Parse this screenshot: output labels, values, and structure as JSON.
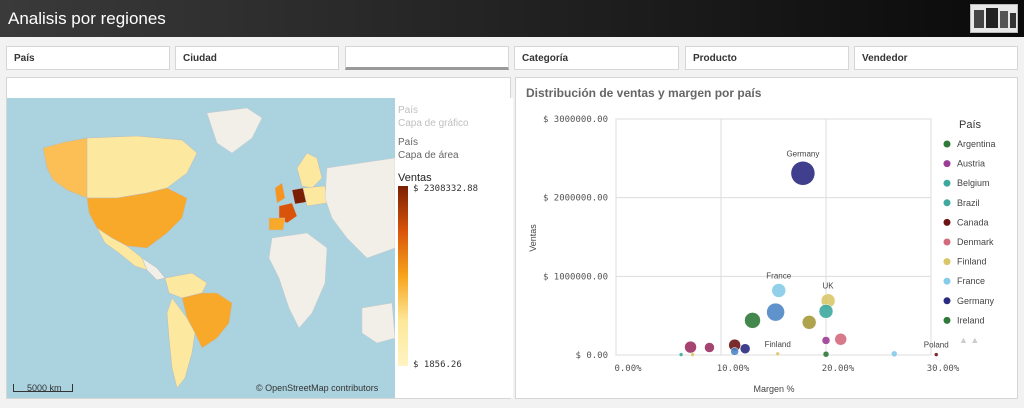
{
  "app": {
    "title": "Analisis por regiones"
  },
  "filters": {
    "pais": "País",
    "ciudad": "Ciudad",
    "empty": "",
    "categoria": "Categoría",
    "producto": "Producto",
    "vendedor": "Vendedor"
  },
  "map": {
    "layer1_name": "País",
    "layer1_sub": "Capa de gráfico",
    "layer2_name": "País",
    "layer2_sub": "Capa de área",
    "legend_title": "Ventas",
    "legend_max": "$ 2308332.88",
    "legend_min": "$ 1856.26",
    "scale": "5000 km",
    "attribution": "© OpenStreetMap contributors",
    "colors": {
      "water": "#aad3df",
      "land": "#f2efe9",
      "low": "#fde89a",
      "high": "#7a1f04"
    }
  },
  "chart": {
    "title": "Distribución de ventas y margen por país",
    "legend_title": "País",
    "chart_data": {
      "type": "scatter",
      "xlabel": "Margen %",
      "ylabel": "Ventas",
      "xlim": [
        0,
        0.3
      ],
      "ylim": [
        0,
        3000000
      ],
      "xticks": [
        "0.00%",
        "10.00%",
        "20.00%",
        "30.00%"
      ],
      "yticks": [
        "$ 0.00",
        "$ 1000000.00",
        "$ 2000000.00",
        "$ 3000000.00"
      ],
      "points": [
        {
          "x": 0.178,
          "y": 2310000,
          "r": 12,
          "color": "#2a2a82",
          "label": "Germany"
        },
        {
          "x": 0.155,
          "y": 820000,
          "r": 7,
          "color": "#86cbe8",
          "label": "France"
        },
        {
          "x": 0.202,
          "y": 690000,
          "r": 7,
          "color": "#d9c669",
          "label": "UK"
        },
        {
          "x": 0.2,
          "y": 555000,
          "r": 7,
          "color": "#3ea89e",
          "label": ""
        },
        {
          "x": 0.152,
          "y": 545000,
          "r": 9,
          "color": "#4f86c6",
          "label": ""
        },
        {
          "x": 0.13,
          "y": 440000,
          "r": 8,
          "color": "#2f7a3a",
          "label": ""
        },
        {
          "x": 0.184,
          "y": 415000,
          "r": 7,
          "color": "#a69a3a",
          "label": ""
        },
        {
          "x": 0.214,
          "y": 200000,
          "r": 6,
          "color": "#d46a7e",
          "label": ""
        },
        {
          "x": 0.2,
          "y": 185000,
          "r": 4,
          "color": "#9b3d94",
          "label": ""
        },
        {
          "x": 0.113,
          "y": 125000,
          "r": 6,
          "color": "#6b1414",
          "label": ""
        },
        {
          "x": 0.071,
          "y": 100000,
          "r": 6,
          "color": "#9b3061",
          "label": ""
        },
        {
          "x": 0.089,
          "y": 95000,
          "r": 5,
          "color": "#9b3061",
          "label": ""
        },
        {
          "x": 0.123,
          "y": 80000,
          "r": 5,
          "color": "#2a2a82",
          "label": ""
        },
        {
          "x": 0.113,
          "y": 45000,
          "r": 4,
          "color": "#4f86c6",
          "label": ""
        },
        {
          "x": 0.154,
          "y": 15000,
          "r": 2,
          "color": "#d9c669",
          "label": "Finland"
        },
        {
          "x": 0.2,
          "y": 10000,
          "r": 3,
          "color": "#2f7a3a",
          "label": ""
        },
        {
          "x": 0.265,
          "y": 15000,
          "r": 3,
          "color": "#86cbe8",
          "label": ""
        },
        {
          "x": 0.305,
          "y": 5000,
          "r": 2,
          "color": "#6b1414",
          "label": "Poland"
        },
        {
          "x": 0.062,
          "y": 5000,
          "r": 2,
          "color": "#3ea89e",
          "label": ""
        },
        {
          "x": 0.073,
          "y": 5000,
          "r": 2,
          "color": "#d9c669",
          "label": ""
        }
      ],
      "legend": [
        {
          "name": "Argentina",
          "color": "#2f7a3a"
        },
        {
          "name": "Austria",
          "color": "#9b3d94"
        },
        {
          "name": "Belgium",
          "color": "#3ea89e"
        },
        {
          "name": "Brazil",
          "color": "#3ea89e"
        },
        {
          "name": "Canada",
          "color": "#6b1414"
        },
        {
          "name": "Denmark",
          "color": "#d46a7e"
        },
        {
          "name": "Finland",
          "color": "#d9c669"
        },
        {
          "name": "France",
          "color": "#86cbe8"
        },
        {
          "name": "Germany",
          "color": "#2a2a82"
        },
        {
          "name": "Ireland",
          "color": "#2f7a3a"
        }
      ]
    }
  }
}
